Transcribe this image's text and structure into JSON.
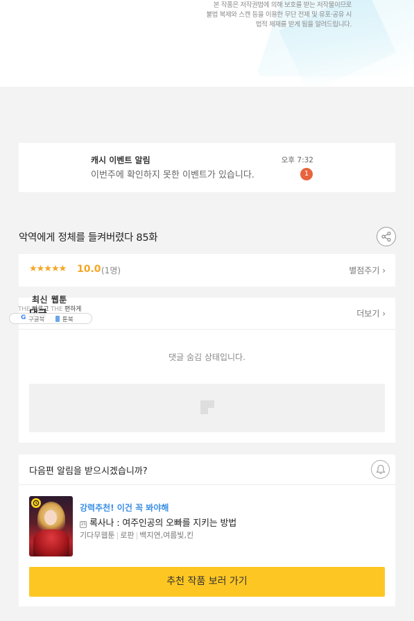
{
  "copyright": {
    "line1": "본 작품은 저작권법에 의해 보호를 받는 저작물이므로",
    "line2": "불법 복제와 스캔 등을 이용한 무단 전재 및 유포·공유 시",
    "line3": "법적 제재를 받게 됨을 알려드립니다."
  },
  "event": {
    "title": "캐시 이벤트 알림",
    "message": "이번주에 확인하지 못한 이벤트가 있습니다.",
    "time": "오후 7:32",
    "badge_count": "1"
  },
  "episode": {
    "title": "악역에게 정체를 들켜버렸다 85화"
  },
  "rating": {
    "stars": "★★★★★",
    "score": "10.0",
    "voters": "(1명)",
    "rate_link": "별점주기 ›"
  },
  "overlay": {
    "title": "최신 웹툰",
    "sub_prefix": "THE",
    "sub_main": "빠르고",
    "sub_mid": "THE",
    "sub_end": "편하게",
    "google_label": "구글북",
    "book_label": "툰북"
  },
  "comments": {
    "label": "댓글",
    "more_link": "더보기 ›",
    "hidden_message": "댓글 숨김 상태입니다."
  },
  "alert": {
    "question": "다음편 알림을 받으시겠습니까?"
  },
  "recommend": {
    "tag": "강력추천! 이건 꼭 봐야해",
    "badge": "15",
    "title": "록사나 : 여주인공의 오빠를 지키는 방법",
    "meta_platform": "기다무웹툰",
    "meta_genre": "로판",
    "meta_authors": "백지연,여름빛,킨",
    "cta": "추천 작품 보러 가기"
  }
}
